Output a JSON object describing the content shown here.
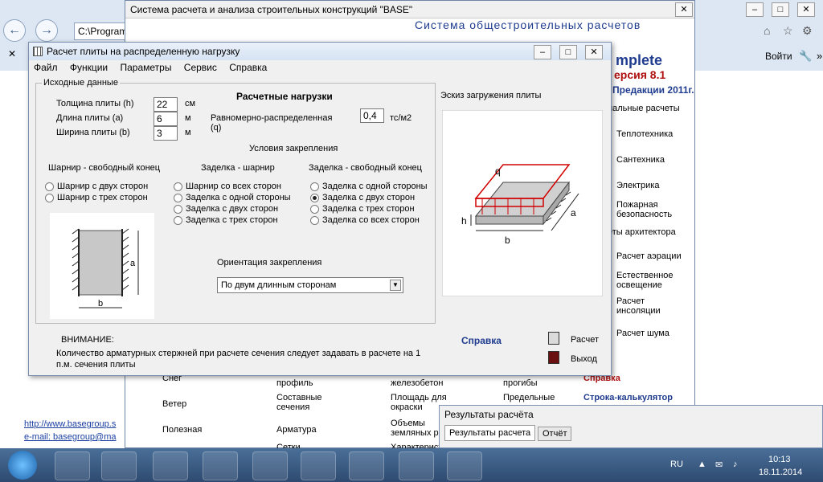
{
  "ie": {
    "address": "C:\\Program",
    "login": "Войти",
    "left_links": [
      "http://www.basegroup.s",
      "e-mail: basegroup@ma"
    ]
  },
  "base": {
    "title": "Система расчета и анализа строительных конструкций  \"BASE\"",
    "subtitle": "Система общестроительных расчетов",
    "brand": "mplete",
    "version": "ерсия 8.1",
    "predicates": "Предакции 2011г.",
    "sidebar_top": "иальные расчеты",
    "sidebar_items": [
      "Теплотехника",
      "Сантехника",
      "Электрика",
      "Пожарная безопасность"
    ],
    "sidebar_mid": "еты архитектора",
    "sidebar_items2": [
      "Расчет аэрации",
      "Естественное освещение",
      "Расчет инсоляции",
      "Расчет шума"
    ],
    "bottom_left": [
      "Снег",
      "Ветер",
      "Полезная"
    ],
    "bottom_mid1": [
      "профиль",
      "Составные сечения",
      "Арматура",
      "Сетки"
    ],
    "bottom_mid2": [
      "железобетон",
      "Площадь для окраски",
      "Объемы земляных ра",
      "Характерист"
    ],
    "bottom_mid3": [
      "прогибы",
      "Предельные"
    ],
    "bottom_right": [
      "Справка",
      "Строка-калькулятор"
    ]
  },
  "dialog": {
    "title": "Расчет плиты на распределенную нагрузку",
    "menu": [
      "Файл",
      "Функции",
      "Параметры",
      "Сервис",
      "Справка"
    ],
    "source_group": "Исходные данные",
    "thickness_label": "Толщина плиты (h)",
    "thickness_value": "22",
    "thickness_unit": "см",
    "length_label": "Длина плиты (a)",
    "length_value": "6",
    "length_unit": "м",
    "width_label": "Ширина плиты (b)",
    "width_value": "3",
    "width_unit": "м",
    "loads_title": "Расчетные нагрузки",
    "load_label": "Равномерно-распределенная (q)",
    "load_value": "0,4",
    "load_unit": "тс/м2",
    "fix_title": "Условия закрепления",
    "col1_title": "Шарнир - свободный конец",
    "col1": [
      "Шарнир с двух сторон",
      "Шарнир с трех сторон"
    ],
    "col2_title": "Заделка - шарнир",
    "col2": [
      "Шарнир со всех сторон",
      "Заделка с одной стороны",
      "Заделка с двух сторон",
      "Заделка с трех сторон"
    ],
    "col3_title": "Заделка - свободный конец",
    "col3": [
      "Заделка с одной стороны",
      "Заделка с двух сторон",
      "Заделка с трех сторон",
      "Заделка со всех сторон"
    ],
    "orientation_label": "Ориентация закрепления",
    "orientation_value": "По двум длинным сторонам",
    "sketch_title": "Эскиз загружения плиты",
    "warning_title": "ВНИМАНИЕ:",
    "warning_text": "Количество арматурных стержней при расчете сечения следует задавать в расчете на 1 п.м. сечения плиты",
    "help": "Справка",
    "calc": "Расчет",
    "exit": "Выход",
    "dim_a": "a",
    "dim_b": "b",
    "dim_h": "h",
    "dim_q": "q"
  },
  "results": {
    "title": "Результаты расчёта",
    "tabs": [
      "Результаты расчета",
      "Отчёт"
    ]
  },
  "taskbar": {
    "lang": "RU",
    "time": "10:13",
    "date": "18.11.2014"
  }
}
